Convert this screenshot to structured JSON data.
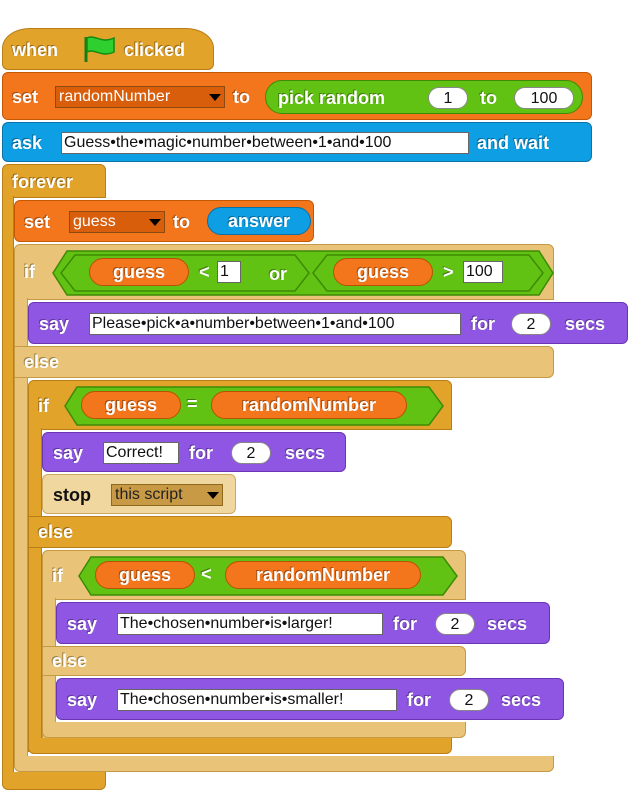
{
  "colors": {
    "control": "#e2a32a",
    "variables": "#f3761d",
    "operators": "#62c213",
    "sensing": "#0e9ee3",
    "looks": "#8f56e3",
    "flag": "#2fcf2f"
  },
  "hat": {
    "when": "when",
    "clicked": "clicked",
    "icon": "green-flag-icon"
  },
  "set1": {
    "set": "set",
    "var": "randomNumber",
    "to": "to",
    "pick": "pick random",
    "from": "1",
    "to2": "to",
    "max": "100"
  },
  "ask": {
    "ask": "ask",
    "question": "Guess•the•magic•number•between•1•and•100",
    "wait": "and wait"
  },
  "forever": {
    "label": "forever"
  },
  "set2": {
    "set": "set",
    "var": "guess",
    "to": "to",
    "value": "answer"
  },
  "if1": {
    "if": "if",
    "var1": "guess",
    "lt": "<",
    "min": "1",
    "or": "or",
    "var2": "guess",
    "gt": ">",
    "max": "100"
  },
  "say1": {
    "say": "say",
    "text": "Please•pick•a•number•between•1•and•100",
    "for": "for",
    "secs_val": "2",
    "secs": "secs"
  },
  "else1": {
    "label": "else"
  },
  "if2": {
    "if": "if",
    "var1": "guess",
    "eq": "=",
    "var2": "randomNumber"
  },
  "say2": {
    "say": "say",
    "text": "Correct!",
    "for": "for",
    "secs_val": "2",
    "secs": "secs"
  },
  "stop": {
    "stop": "stop",
    "option": "this script"
  },
  "else2": {
    "label": "else"
  },
  "if3": {
    "if": "if",
    "var1": "guess",
    "lt": "<",
    "var2": "randomNumber"
  },
  "say3": {
    "say": "say",
    "text": "The•chosen•number•is•larger!",
    "for": "for",
    "secs_val": "2",
    "secs": "secs"
  },
  "else3": {
    "label": "else"
  },
  "say4": {
    "say": "say",
    "text": "The•chosen•number•is•smaller!",
    "for": "for",
    "secs_val": "2",
    "secs": "secs"
  }
}
